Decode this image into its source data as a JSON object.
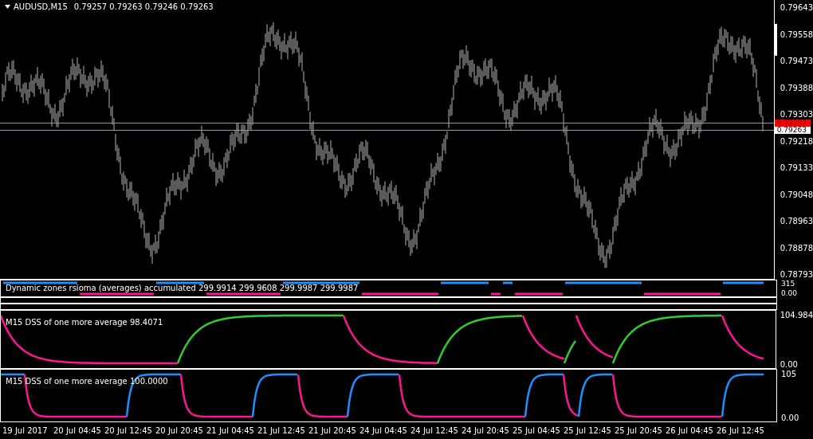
{
  "chart": {
    "symbol": "AUDUSD,M15",
    "quotes": [
      "0.79257",
      "0.79263",
      "0.79246",
      "0.79263"
    ],
    "price_axis": [
      "0.79643",
      "0.79558",
      "0.79473",
      "0.79388",
      "0.79303",
      "0.79218",
      "0.79133",
      "0.79048",
      "0.78963",
      "0.78878",
      "0.78793"
    ],
    "price_tags": [
      {
        "text": "0.79287",
        "kind": "ask",
        "color": "#ff0000"
      },
      {
        "text": "0.79263",
        "kind": "bid",
        "color": "#ffffff"
      }
    ]
  },
  "indicators": [
    {
      "kind": "rsioma",
      "label": "Dynamic zones rsioma (averages) accumulated 299.9914 299.9608 299.9987 299.9987",
      "axis": [
        "315",
        "0.00"
      ]
    },
    {
      "kind": "empty"
    },
    {
      "kind": "empty"
    },
    {
      "kind": "dss",
      "label": "M15 DSS of one more average 98.4071",
      "axis": [
        "104.984",
        "0.00"
      ]
    },
    {
      "kind": "dss",
      "label": "M15 DSS of one more average 100.0000",
      "axis": [
        "105",
        "0.00"
      ]
    }
  ],
  "time_axis": [
    "19 Jul 2017",
    "20 Jul 04:45",
    "20 Jul 12:45",
    "20 Jul 20:45",
    "21 Jul 04:45",
    "21 Jul 12:45",
    "21 Jul 20:45",
    "24 Jul 04:45",
    "24 Jul 12:45",
    "24 Jul 20:45",
    "25 Jul 04:45",
    "25 Jul 12:45",
    "25 Jul 20:45",
    "26 Jul 04:45",
    "26 Jul 12:45"
  ]
}
